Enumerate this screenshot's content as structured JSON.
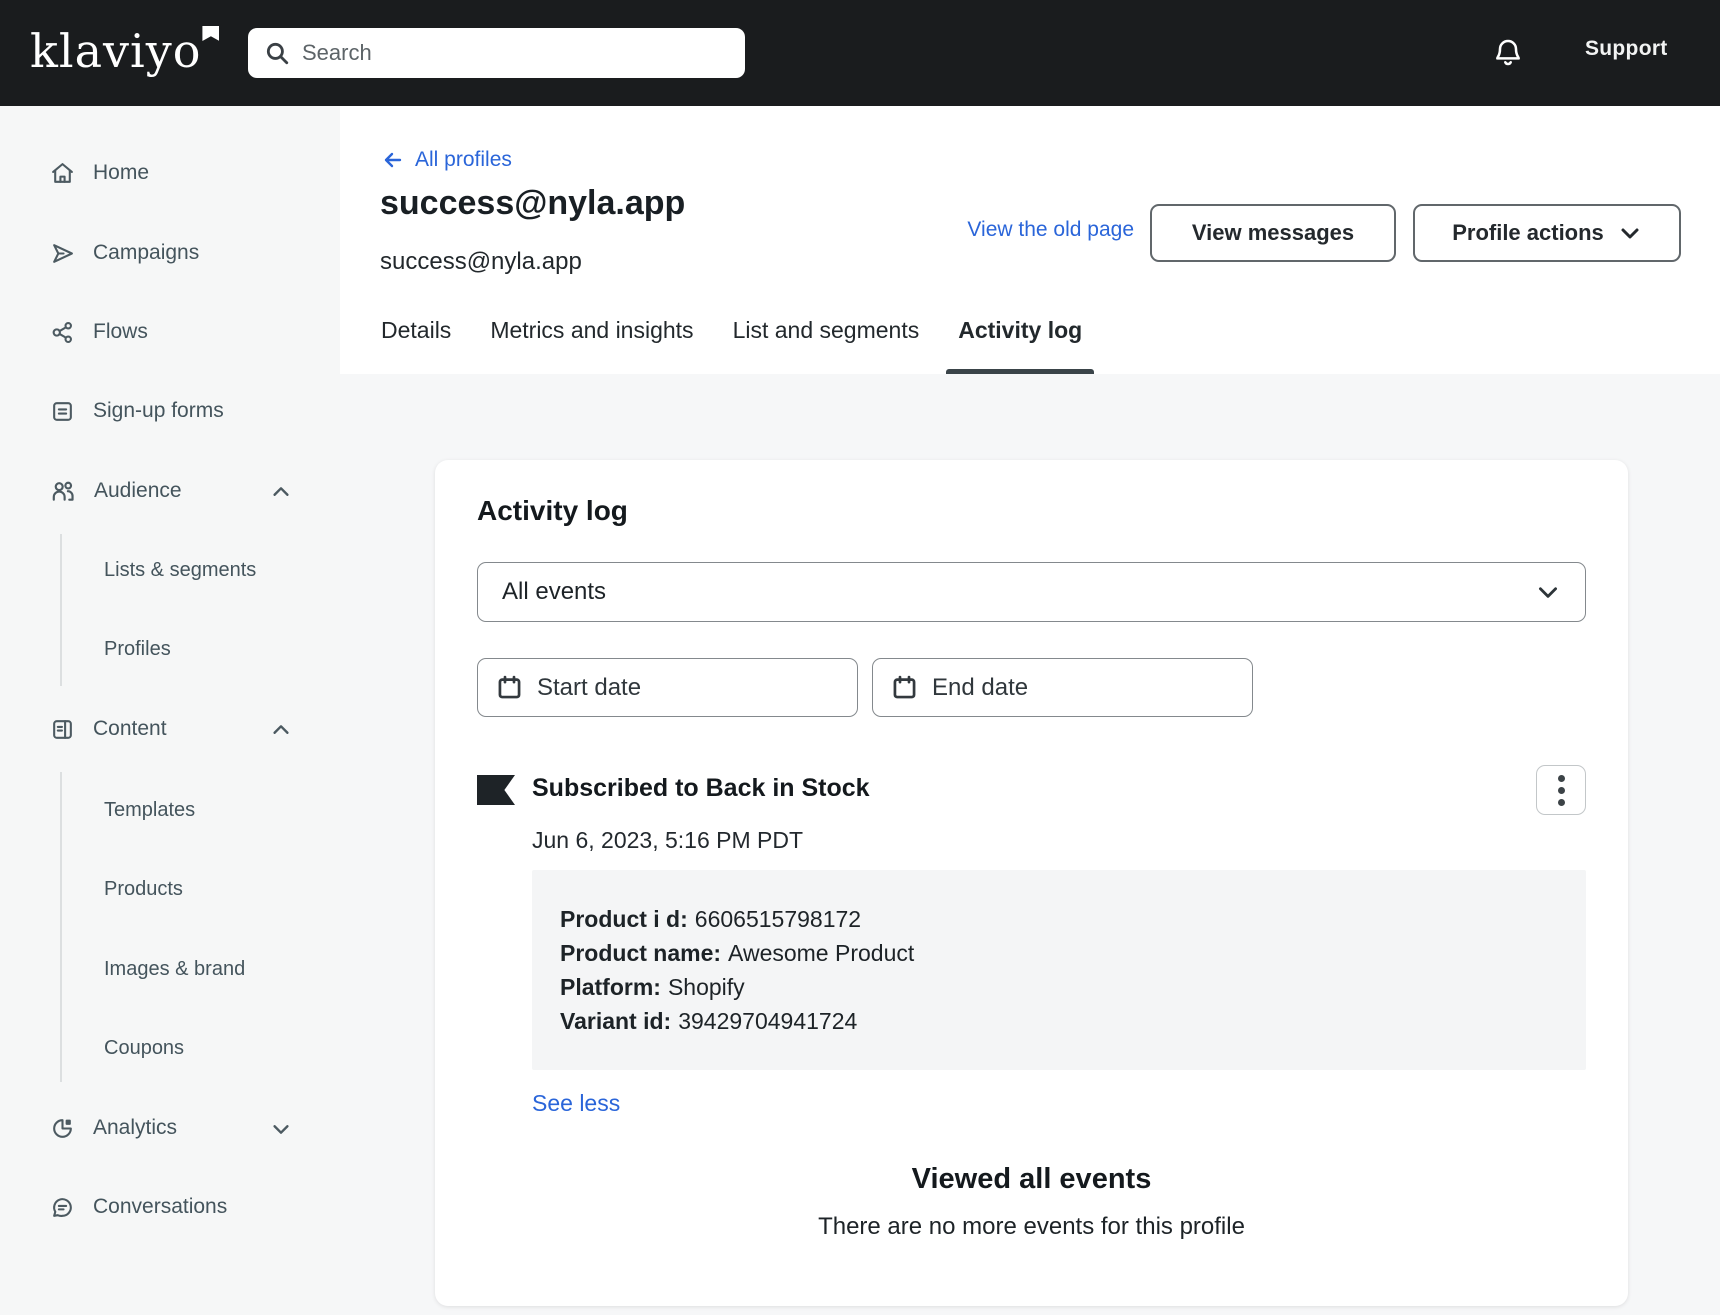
{
  "header": {
    "brand": "klaviyo",
    "search_placeholder": "Search",
    "support_label": "Support"
  },
  "sidebar": {
    "items": [
      {
        "label": "Home",
        "icon": "home-icon"
      },
      {
        "label": "Campaigns",
        "icon": "send-icon"
      },
      {
        "label": "Flows",
        "icon": "flows-icon"
      },
      {
        "label": "Sign-up forms",
        "icon": "form-icon"
      },
      {
        "label": "Audience",
        "icon": "audience-icon",
        "expanded": true,
        "children": [
          "Lists & segments",
          "Profiles"
        ]
      },
      {
        "label": "Content",
        "icon": "content-icon",
        "expanded": true,
        "children": [
          "Templates",
          "Products",
          "Images & brand",
          "Coupons"
        ]
      },
      {
        "label": "Analytics",
        "icon": "analytics-icon",
        "expanded": false
      },
      {
        "label": "Conversations",
        "icon": "conversations-icon"
      }
    ]
  },
  "profile_header": {
    "back_link": "All profiles",
    "title": "success@nyla.app",
    "subtitle": "success@nyla.app",
    "old_page_link": "View the old page",
    "view_messages_label": "View messages",
    "profile_actions_label": "Profile actions"
  },
  "tabs": [
    {
      "label": "Details",
      "active": false
    },
    {
      "label": "Metrics and insights",
      "active": false
    },
    {
      "label": "List and segments",
      "active": false
    },
    {
      "label": "Activity log",
      "active": true
    }
  ],
  "activity": {
    "heading": "Activity log",
    "filter_value": "All events",
    "start_date_placeholder": "Start date",
    "end_date_placeholder": "End date",
    "event": {
      "title": "Subscribed to Back in Stock",
      "timestamp": "Jun 6, 2023, 5:16 PM PDT",
      "details": [
        {
          "label": "Product i d:",
          "value": "6606515798172"
        },
        {
          "label": "Product name:",
          "value": "Awesome Product"
        },
        {
          "label": "Platform:",
          "value": "Shopify"
        },
        {
          "label": "Variant id:",
          "value": "39429704941724"
        }
      ],
      "see_less_label": "See less"
    },
    "end_state": {
      "title": "Viewed all events",
      "message": "There are no more events for this profile"
    }
  },
  "colors": {
    "accent_blue": "#2a65d9",
    "topbar_bg": "#1a1c1e",
    "sidebar_bg": "#f6f7f7",
    "page_bg": "#f6f7f8"
  }
}
